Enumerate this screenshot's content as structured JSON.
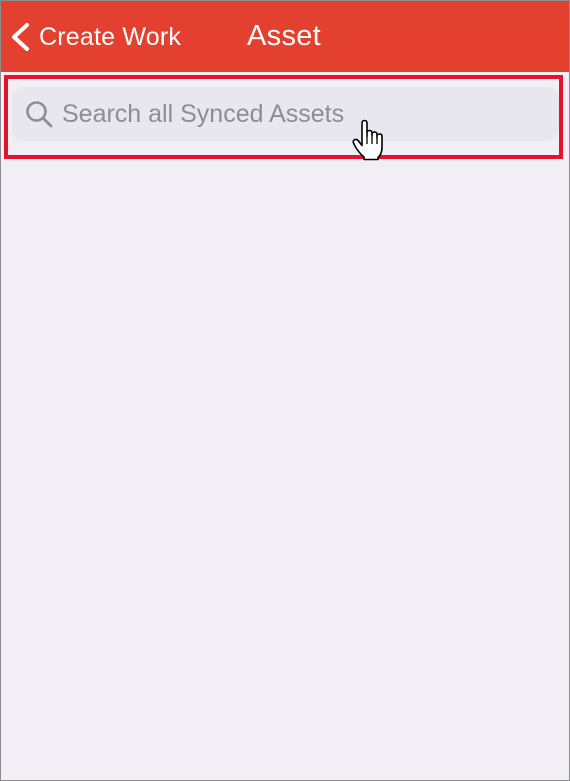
{
  "navbar": {
    "back_label": "Create Work",
    "title": "Asset",
    "background_color": "#e4402f"
  },
  "search": {
    "placeholder": "Search all Synced Assets",
    "value": "",
    "highlight_color": "#e4122c"
  },
  "icons": {
    "back": "chevron-left-icon",
    "search": "magnifier-icon",
    "pointer": "hand-pointer-icon"
  }
}
